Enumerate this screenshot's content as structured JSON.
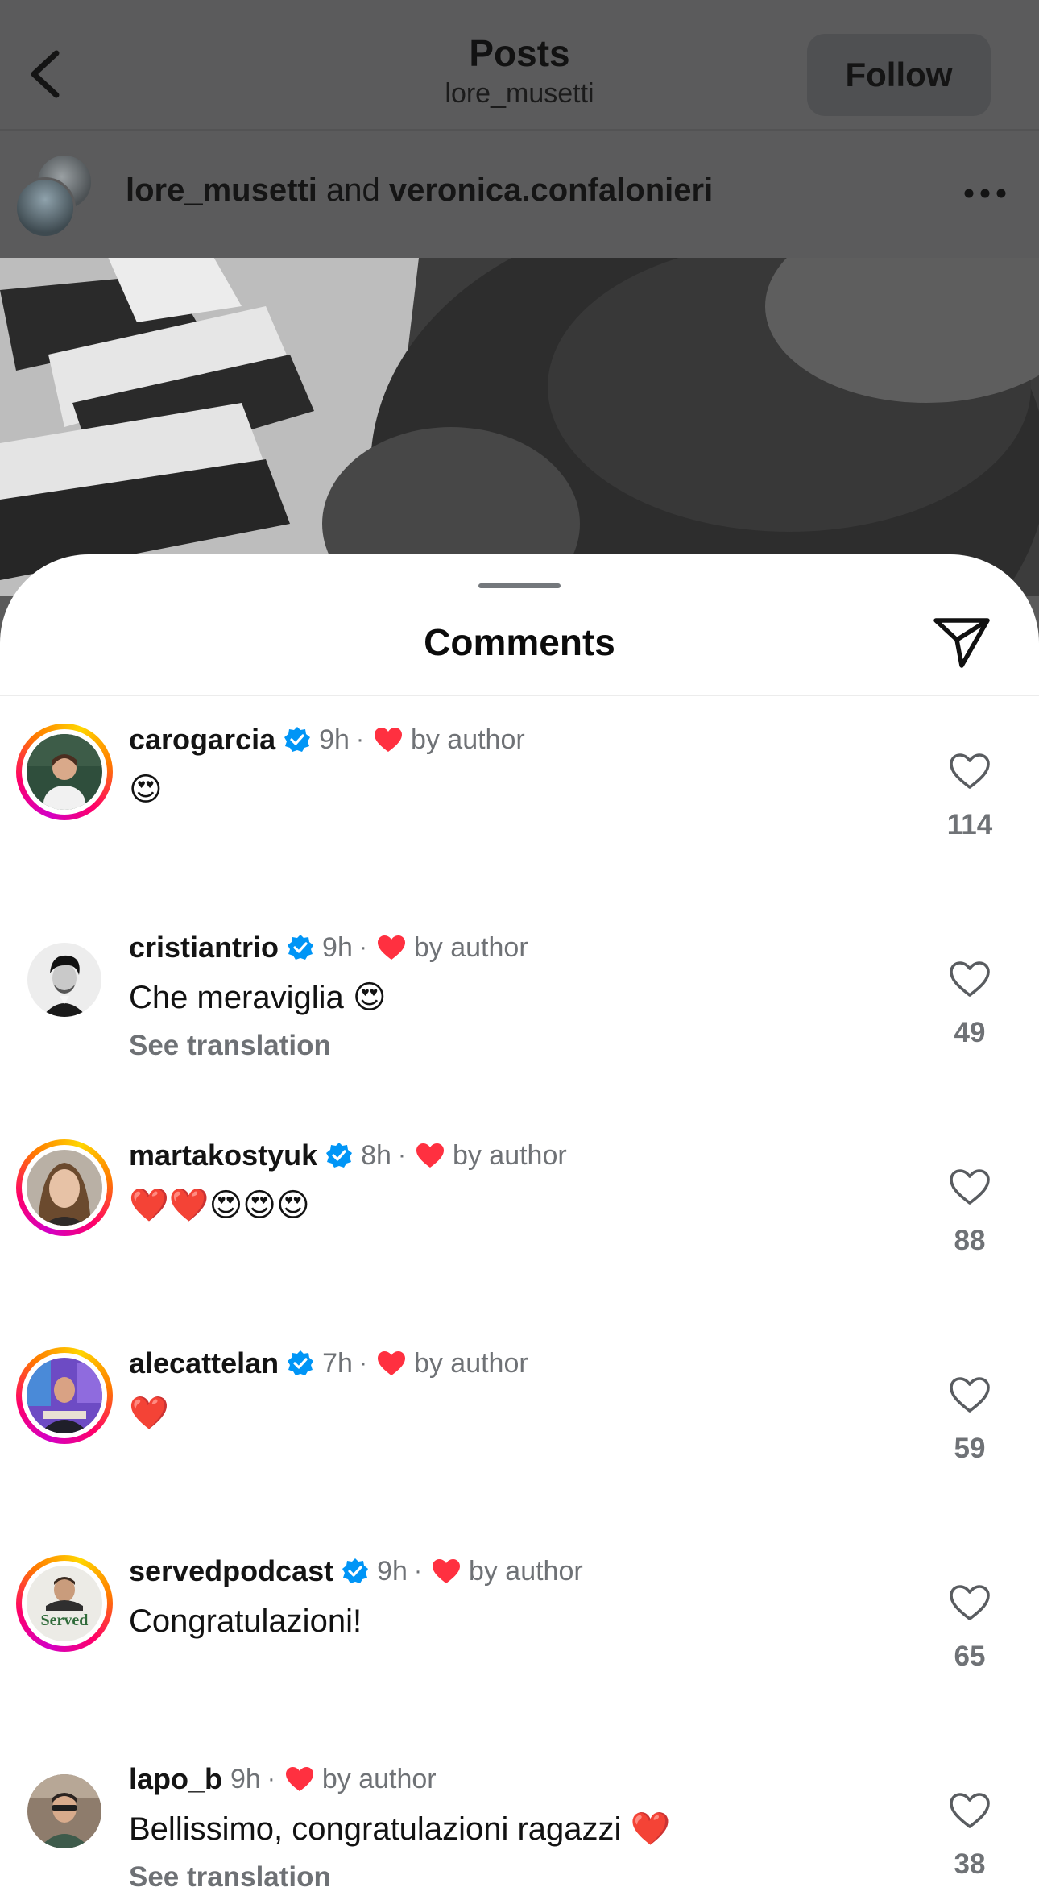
{
  "header": {
    "title": "Posts",
    "subtitle": "lore_musetti",
    "follow_label": "Follow"
  },
  "post_author": {
    "user1": "lore_musetti",
    "joiner": "and",
    "user2": "veronica.confalonieri"
  },
  "sheet": {
    "title": "Comments"
  },
  "comments": [
    {
      "username": "caro​garcia",
      "verified": true,
      "time": "9h",
      "sep": "·",
      "by_author": "by author",
      "text": "😍",
      "translate": "",
      "likes": "114"
    },
    {
      "username": "cristiantrio",
      "verified": true,
      "time": "9h",
      "sep": "·",
      "by_author": "by author",
      "text": "Che meraviglia 😍",
      "translate": "See translation",
      "likes": "49"
    },
    {
      "username": "martakostyuk",
      "verified": true,
      "time": "8h",
      "sep": "·",
      "by_author": "by author",
      "text": "❤️❤️😍😍😍",
      "translate": "",
      "likes": "88"
    },
    {
      "username": "alecattelan",
      "verified": true,
      "time": "7h",
      "sep": "·",
      "by_author": "by author",
      "text": "❤️",
      "translate": "",
      "likes": "59"
    },
    {
      "username": "servedpodcast",
      "verified": true,
      "time": "9h",
      "sep": "·",
      "by_author": "by author",
      "text": "Congratulazioni!",
      "translate": "",
      "likes": "65"
    },
    {
      "username": "lapo_b",
      "verified": false,
      "time": "9h",
      "sep": "·",
      "by_author": "by author",
      "text": "Bellissimo, congratulazioni ragazzi ❤️",
      "translate": "See translation",
      "likes": "38"
    }
  ],
  "avatar_logo_text": "Served",
  "colors": {
    "verified_blue": "#0095f6",
    "heart_red": "#ff3040",
    "secondary_text": "#6f7276"
  }
}
